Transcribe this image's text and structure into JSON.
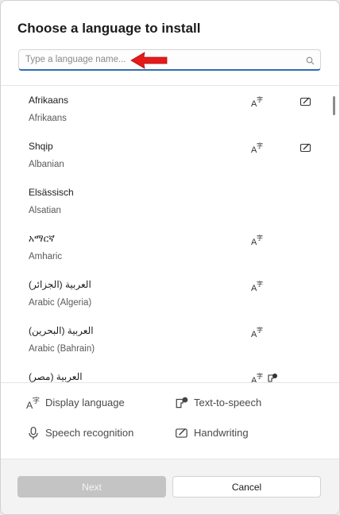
{
  "dialog": {
    "title": "Choose a language to install",
    "search": {
      "placeholder": "Type a language name...",
      "value": ""
    },
    "languages": [
      {
        "native": "Afrikaans",
        "english": "Afrikaans",
        "features": [
          "display-language",
          "handwriting"
        ]
      },
      {
        "native": "Shqip",
        "english": "Albanian",
        "features": [
          "display-language",
          "handwriting"
        ]
      },
      {
        "native": "Elsässisch",
        "english": "Alsatian",
        "features": []
      },
      {
        "native": "አማርኛ",
        "english": "Amharic",
        "features": [
          "display-language"
        ]
      },
      {
        "native": "العربية (الجزائر)",
        "english": "Arabic (Algeria)",
        "features": [
          "display-language"
        ]
      },
      {
        "native": "العربية (البحرين)",
        "english": "Arabic (Bahrain)",
        "features": [
          "display-language"
        ]
      },
      {
        "native": "العربية (مصر)",
        "english": "",
        "features": [
          "display-language",
          "text-to-speech"
        ]
      }
    ],
    "legend": {
      "display_language": "Display language",
      "text_to_speech": "Text-to-speech",
      "speech_recognition": "Speech recognition",
      "handwriting": "Handwriting"
    },
    "buttons": {
      "next": "Next",
      "cancel": "Cancel"
    },
    "colors": {
      "accent": "#2f6fb0",
      "annotation_arrow": "#e31b1b",
      "disabled_button": "#c4c4c4"
    },
    "icons": [
      "search-icon",
      "display-language-icon",
      "handwriting-icon",
      "text-to-speech-icon",
      "microphone-icon"
    ]
  }
}
